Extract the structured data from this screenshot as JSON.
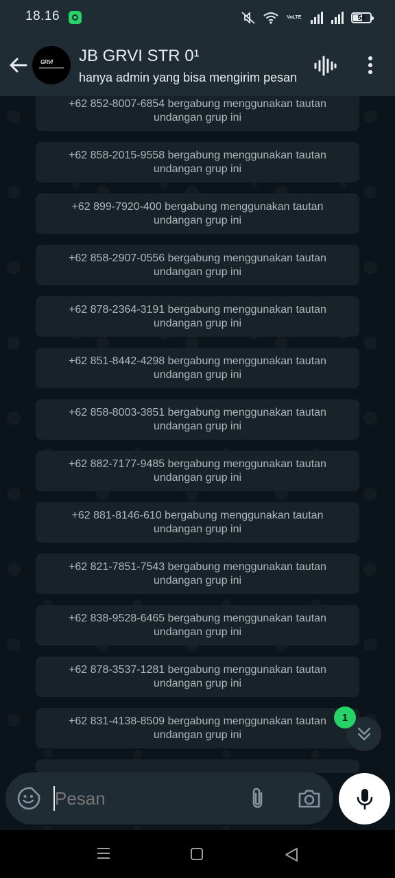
{
  "status_bar": {
    "time": "18.16",
    "network_label": "VoLTE",
    "battery_level": "54"
  },
  "header": {
    "title": "JB GRVI STR 0¹",
    "subtitle": "hanya admin yang bisa mengirim pesan"
  },
  "messages": [
    {
      "line1": "+62 852-8007-6854 bergabung menggunakan tautan",
      "line2": "undangan grup ini"
    },
    {
      "line1": "+62 858-2015-9558 bergabung menggunakan tautan",
      "line2": "undangan grup ini"
    },
    {
      "line1": "+62 899-7920-400 bergabung menggunakan tautan",
      "line2": "undangan grup ini"
    },
    {
      "line1": "+62 858-2907-0556 bergabung menggunakan tautan",
      "line2": "undangan grup ini"
    },
    {
      "line1": "+62 878-2364-3191 bergabung menggunakan tautan",
      "line2": "undangan grup ini"
    },
    {
      "line1": "+62 851-8442-4298 bergabung menggunakan tautan",
      "line2": "undangan grup ini"
    },
    {
      "line1": "+62 858-8003-3851 bergabung menggunakan tautan",
      "line2": "undangan grup ini"
    },
    {
      "line1": "+62 882-7177-9485 bergabung menggunakan tautan",
      "line2": "undangan grup ini"
    },
    {
      "line1": "+62 881-8146-610 bergabung menggunakan tautan",
      "line2": "undangan grup ini"
    },
    {
      "line1": "+62 821-7851-7543 bergabung menggunakan tautan",
      "line2": "undangan grup ini"
    },
    {
      "line1": "+62 838-9528-6465 bergabung menggunakan tautan",
      "line2": "undangan grup ini"
    },
    {
      "line1": "+62 878-3537-1281 bergabung menggunakan tautan",
      "line2": "undangan grup ini"
    },
    {
      "line1": "+62 831-4138-8509 bergabung menggunakan tautan",
      "line2": "undangan grup ini"
    }
  ],
  "unread_badge": "1",
  "composer": {
    "placeholder": "Pesan",
    "value": ""
  },
  "colors": {
    "background": "#0b141a",
    "bar": "#1f2c34",
    "system_bubble": "#182229",
    "accent": "#25d366"
  },
  "icons": {
    "back": "arrow-left-icon",
    "voice_chat": "audio-wave-icon",
    "menu": "more-vertical-icon",
    "sticker": "sticker-icon",
    "attach": "paperclip-icon",
    "camera": "camera-icon",
    "mic": "microphone-icon",
    "scroll_down": "double-chevron-down-icon"
  }
}
